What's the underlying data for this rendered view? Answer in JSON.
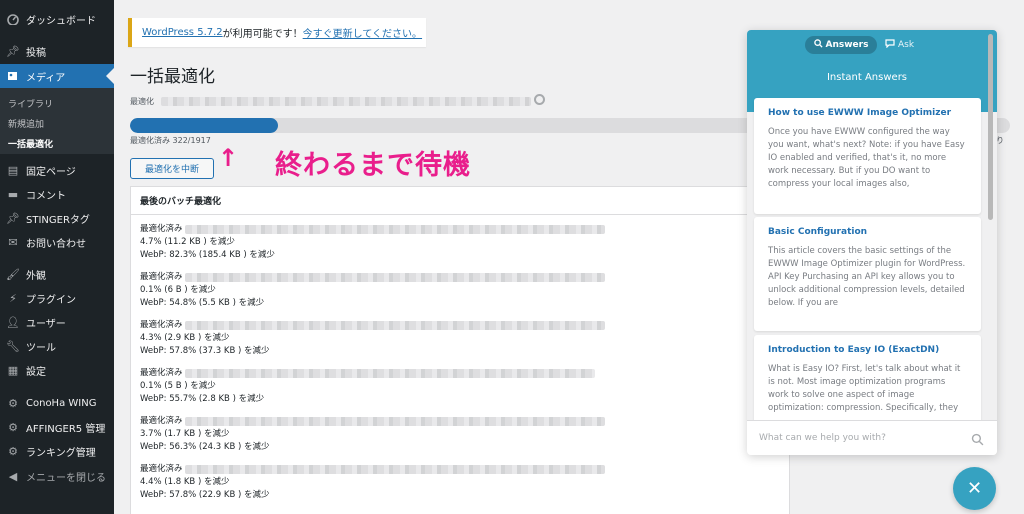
{
  "sidebar": {
    "items": [
      {
        "label": "ダッシュボード",
        "icon": "dashboard-icon"
      },
      {
        "label": "投稿",
        "icon": "pin-icon"
      },
      {
        "label": "メディア",
        "icon": "media-icon"
      },
      {
        "label": "固定ページ",
        "icon": "page-icon"
      },
      {
        "label": "コメント",
        "icon": "comment-icon"
      },
      {
        "label": "STINGERタグ",
        "icon": "pin-icon"
      },
      {
        "label": "お問い合わせ",
        "icon": "mail-icon"
      },
      {
        "label": "外観",
        "icon": "brush-icon"
      },
      {
        "label": "プラグイン",
        "icon": "plugin-icon"
      },
      {
        "label": "ユーザー",
        "icon": "user-icon"
      },
      {
        "label": "ツール",
        "icon": "wrench-icon"
      },
      {
        "label": "設定",
        "icon": "settings-icon"
      },
      {
        "label": "ConoHa WING",
        "icon": "gear-icon"
      },
      {
        "label": "AFFINGER5 管理",
        "icon": "gear-icon"
      },
      {
        "label": "ランキング管理",
        "icon": "gear-icon"
      },
      {
        "label": "メニューを閉じる",
        "icon": "collapse-icon"
      }
    ],
    "submenu": [
      "ライブラリ",
      "新規追加",
      "一括最適化"
    ]
  },
  "notice": {
    "version_link": "WordPress 5.7.2",
    "middle": " が利用可能です！",
    "update_link": "今すぐ更新してください。"
  },
  "page": {
    "title": "一括最適化",
    "optimizing_label": "最適化",
    "progress_text": "最適化済み 322/1917",
    "progress_fraction": 0.168,
    "progress_tail": "り",
    "stop_button": "最適化を中断",
    "annotation_arrow": "↑",
    "annotation_text": "終わるまで待機"
  },
  "batch": {
    "header": "最後のバッチ最適化",
    "entries": [
      {
        "label": "最適化済み",
        "saved": "4.7% (11.2 KB ) を減少",
        "webp": "WebP: 82.3% (185.4 KB ) を減少"
      },
      {
        "label": "最適化済み",
        "saved": "0.1% (6 B ) を減少",
        "webp": "WebP: 54.8% (5.5 KB ) を減少"
      },
      {
        "label": "最適化済み",
        "saved": "4.3% (2.9 KB ) を減少",
        "webp": "WebP: 57.8% (37.3 KB ) を減少"
      },
      {
        "label": "最適化済み",
        "saved": "0.1% (5 B ) を減少",
        "webp": "WebP: 55.7% (2.8 KB ) を減少"
      },
      {
        "label": "最適化済み",
        "saved": "3.7% (1.7 KB ) を減少",
        "webp": "WebP: 56.3% (24.3 KB ) を減少"
      },
      {
        "label": "最適化済み",
        "saved": "4.4% (1.8 KB ) を減少",
        "webp": "WebP: 57.8% (22.9 KB ) を減少"
      }
    ]
  },
  "help": {
    "tab_answers": "Answers",
    "tab_ask": "Ask",
    "title": "Instant Answers",
    "articles": [
      {
        "title": "How to use EWWW Image Optimizer",
        "body": "Once you have EWWW configured the way you want, what's next? Note: if you have Easy IO enabled and verified, that's it, no more work necessary. But if you DO want to compress your local images also,"
      },
      {
        "title": "Basic Configuration",
        "body": "This article covers the basic settings of the EWWW Image Optimizer plugin for WordPress. API Key Purchasing an API key allows you to unlock additional compression levels, detailed below. If you are"
      },
      {
        "title": "Introduction to Easy IO (ExactDN)",
        "body": "What is Easy IO? First, let's talk about what it is not. Most image optimization programs work to solve one aspect of image optimization: compression. Specifically, they"
      }
    ],
    "search_placeholder": "What can we help you with?",
    "close_symbol": "✕"
  },
  "colors": {
    "sidebar_bg": "#1d2327",
    "active_bg": "#2271b1",
    "accent": "#36a2c1",
    "annotation": "#e91e8c",
    "notice_border": "#dba617"
  }
}
